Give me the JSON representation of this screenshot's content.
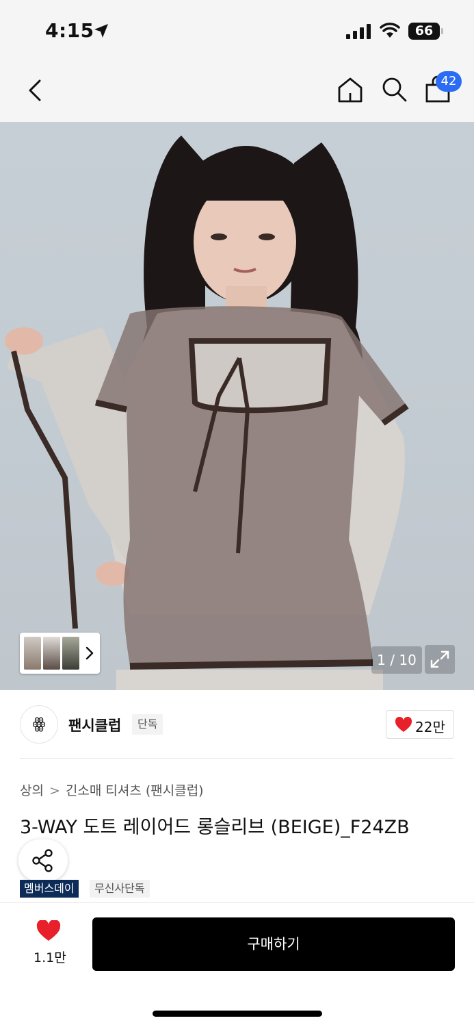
{
  "status_bar": {
    "time": "4:15",
    "battery": "66",
    "icons": [
      "location-arrow-icon",
      "signal-icon",
      "wifi-icon",
      "battery-icon"
    ]
  },
  "nav": {
    "cart_count": "42",
    "icons": [
      "chevron-left-icon",
      "home-icon",
      "search-icon",
      "bag-icon"
    ]
  },
  "gallery": {
    "counter": "1 / 10",
    "current_index": 1,
    "total": 10,
    "icons": [
      "chevron-right-icon",
      "expand-icon"
    ]
  },
  "brand": {
    "logo_text": "ꙮ",
    "name": "팬시클럽",
    "exclusive_tag": "단독",
    "likes": "22만"
  },
  "product": {
    "breadcrumb": [
      "상의",
      "긴소매 티셔츠 (팬시클럽)"
    ],
    "breadcrumb_separator": ">",
    "title": "3-WAY 도트 레이어드 롱슬리브 (BEIGE)_F24ZB",
    "tags": [
      "멤버스데이",
      "무신사단독"
    ]
  },
  "bottom_bar": {
    "wish_count": "1.1만",
    "buy_label": "구매하기"
  },
  "colors": {
    "accent_badge": "#2b6cf5",
    "heart": "#e8202a",
    "member_tag": "#0d2b57",
    "buy_button": "#000000"
  }
}
